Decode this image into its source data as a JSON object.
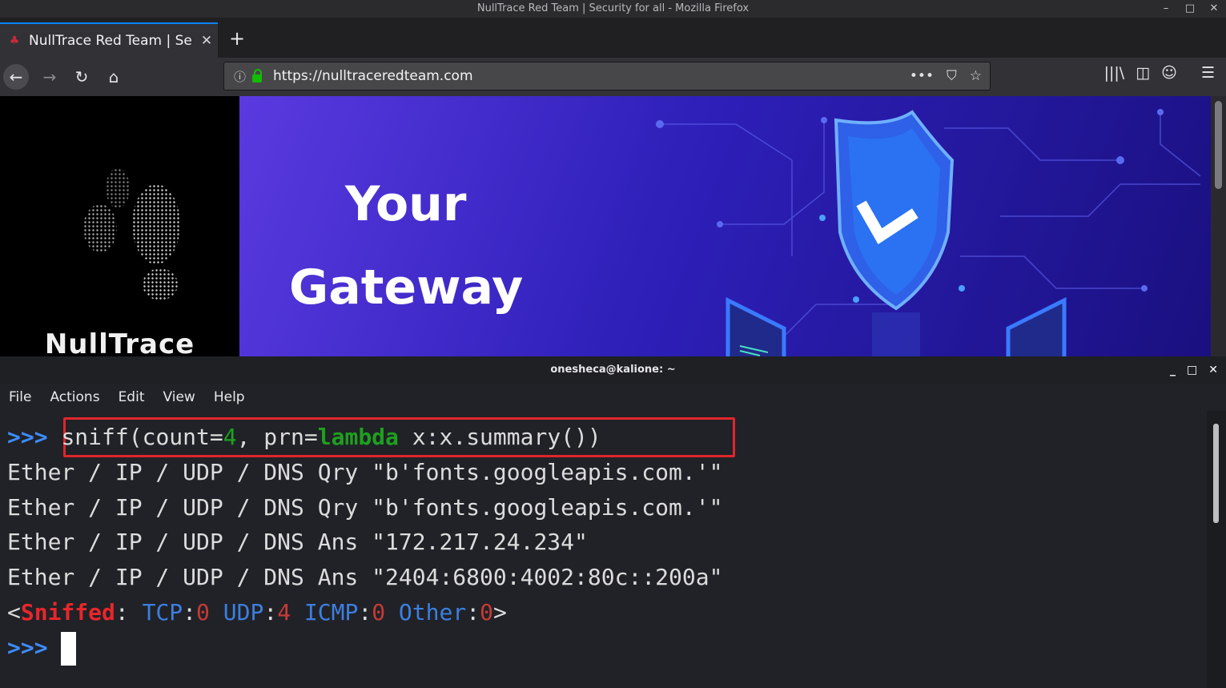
{
  "firefox": {
    "window_title": "NullTrace Red Team | Security for all - Mozilla Firefox",
    "window_controls": [
      "–",
      "□",
      "✕"
    ],
    "tab": {
      "title": "NullTrace Red Team | Se",
      "close": "✕"
    },
    "new_tab": "+",
    "nav": {
      "back": "←",
      "forward": "→",
      "reload": "↻",
      "home": "⌂"
    },
    "url": "https://nulltraceredteam.com",
    "url_icons": {
      "info": "ⓘ",
      "more": "•••",
      "pocket": "⛉",
      "bookmark": "☆"
    },
    "toolbar_right": {
      "library": "|||\\",
      "sidebar": "◫",
      "account": "☺",
      "menu": "☰"
    }
  },
  "page": {
    "brand": "NullTrace",
    "hero_line1": "Your",
    "hero_line2": "Gateway"
  },
  "terminal": {
    "title": "onesheca@kalione: ~",
    "window_controls": [
      "_",
      "□",
      "✕"
    ],
    "menu": [
      "File",
      "Actions",
      "Edit",
      "View",
      "Help"
    ],
    "prompt": ">>>",
    "command": {
      "p1": "sniff(count=",
      "p2": "4",
      "p3": ", prn=",
      "p4": "lambda",
      "p5": " x:x.summary())"
    },
    "output": [
      "Ether / IP / UDP / DNS Qry \"b'fonts.googleapis.com.'\"",
      "Ether / IP / UDP / DNS Qry \"b'fonts.googleapis.com.'\"",
      "Ether / IP / UDP / DNS Ans \"172.217.24.234\"",
      "Ether / IP / UDP / DNS Ans \"2404:6800:4002:80c::200a\""
    ],
    "summary": {
      "open": "<",
      "sniffed": "Sniffed",
      "colon": ": ",
      "tcp_label": "TCP",
      "tcp": "0",
      "udp_label": "UDP",
      "udp": "4",
      "icmp_label": "ICMP",
      "icmp": "0",
      "other_label": "Other",
      "other": "0",
      "close": ">"
    }
  }
}
